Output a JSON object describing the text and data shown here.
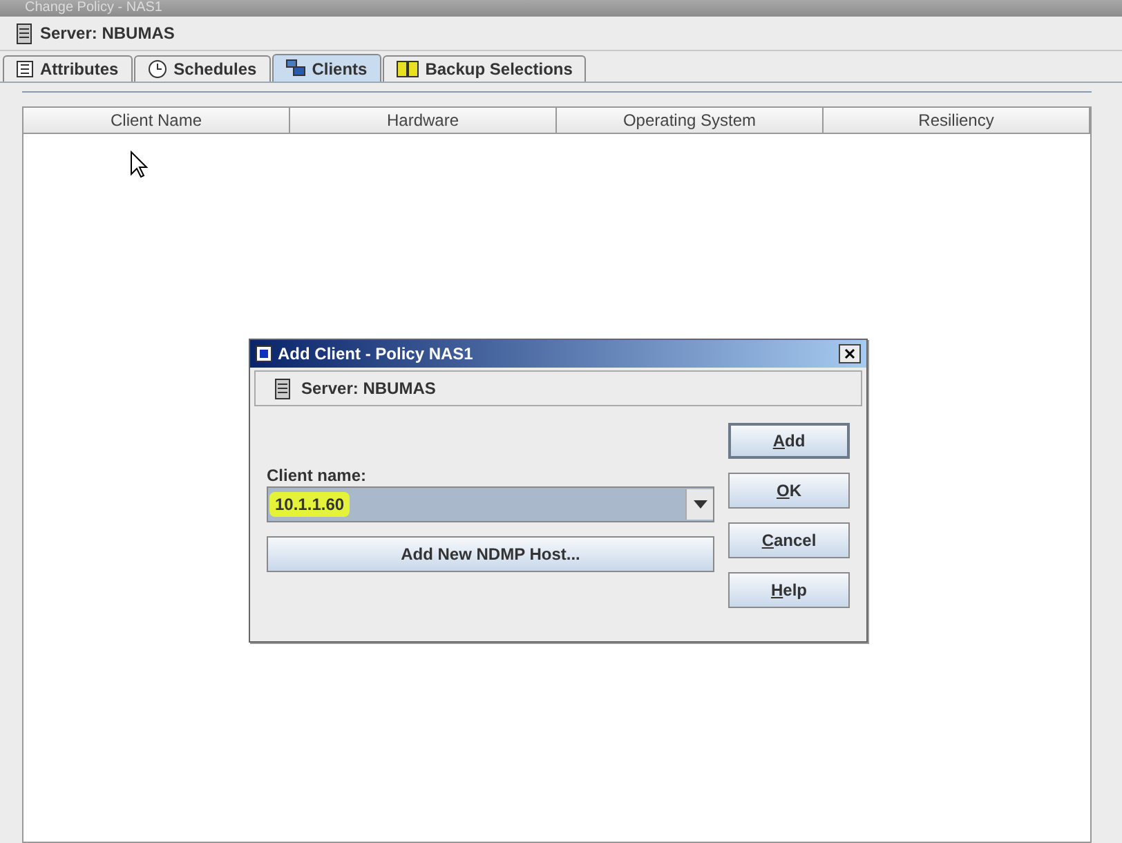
{
  "window": {
    "title": "Change Policy - NAS1"
  },
  "server": {
    "label": "Server: NBUMAS"
  },
  "tabs": [
    {
      "label": "Attributes",
      "selected": false
    },
    {
      "label": "Schedules",
      "selected": false
    },
    {
      "label": "Clients",
      "selected": true
    },
    {
      "label": "Backup Selections",
      "selected": false
    }
  ],
  "table": {
    "columns": [
      "Client Name",
      "Hardware",
      "Operating System",
      "Resiliency"
    ]
  },
  "dialog": {
    "title": "Add Client - Policy NAS1",
    "server": "Server: NBUMAS",
    "field_label": "Client name:",
    "value": "10.1.1.60",
    "highlighted": true,
    "host_button": "Add New NDMP Host...",
    "buttons": [
      {
        "label": "Add",
        "default": true,
        "underline_first": true
      },
      {
        "label": "OK",
        "default": false,
        "underline_first": true
      },
      {
        "label": "Cancel",
        "default": false,
        "underline_first": true
      },
      {
        "label": "Help",
        "default": false,
        "underline_first": true
      }
    ]
  }
}
